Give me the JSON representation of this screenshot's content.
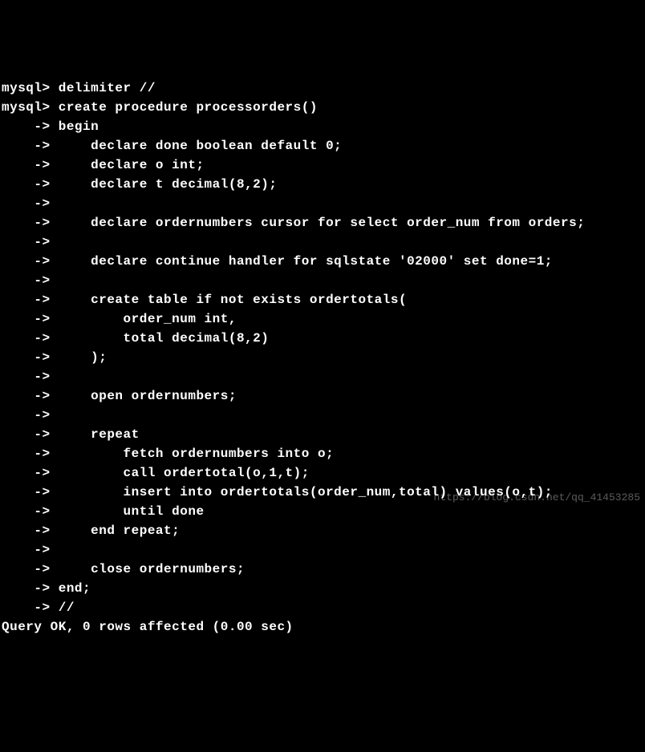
{
  "terminal": {
    "lines": [
      "mysql> delimiter //",
      "mysql> create procedure processorders()",
      "    -> begin",
      "    ->     declare done boolean default 0;",
      "    ->     declare o int;",
      "    ->     declare t decimal(8,2);",
      "    ->",
      "    ->     declare ordernumbers cursor for select order_num from orders;",
      "    ->",
      "    ->     declare continue handler for sqlstate '02000' set done=1;",
      "    ->",
      "    ->     create table if not exists ordertotals(",
      "    ->         order_num int,",
      "    ->         total decimal(8,2)",
      "    ->     );",
      "    ->",
      "    ->     open ordernumbers;",
      "    ->",
      "    ->     repeat",
      "    ->         fetch ordernumbers into o;",
      "    ->         call ordertotal(o,1,t);",
      "    ->         insert into ordertotals(order_num,total) values(o,t);",
      "    ->         until done",
      "    ->     end repeat;",
      "    ->",
      "    ->     close ordernumbers;",
      "    -> end;",
      "    -> //",
      "Query OK, 0 rows affected (0.00 sec)"
    ]
  },
  "watermark": "https://blog.csdn.net/qq_41453285"
}
